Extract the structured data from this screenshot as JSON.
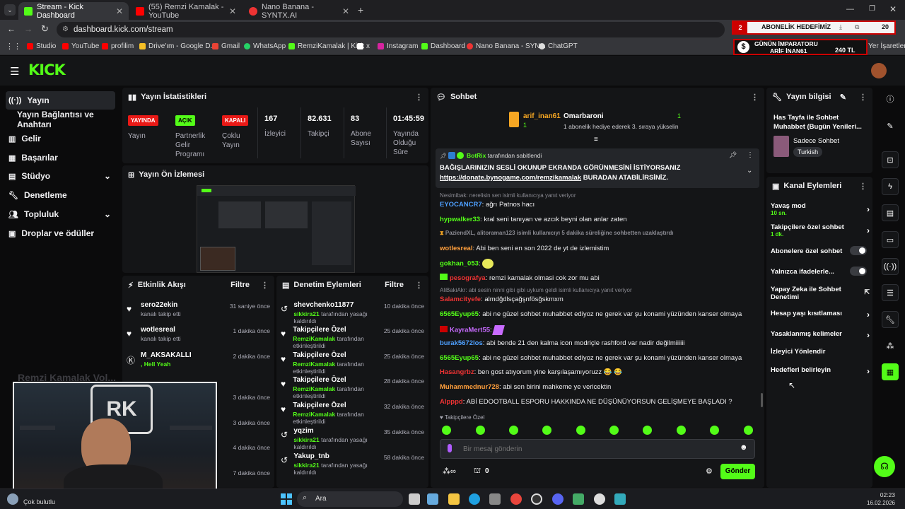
{
  "browser": {
    "tabs": [
      {
        "title": "Stream - Kick Dashboard",
        "color": "#53fc18"
      },
      {
        "title": "(55) Remzi Kamalak - YouTube",
        "color": "#ff0000"
      },
      {
        "title": "Nano Banana - SYNTX.AI",
        "color": "#e33"
      }
    ],
    "url": "dashboard.kick.com/stream",
    "bookmarks": [
      "Studio",
      "YouTube",
      "profilim",
      "Drive'ım - Google D...",
      "Gmail",
      "WhatsApp",
      "RemziKamalak | Kick",
      "x",
      "Instagram",
      "Dashboard",
      "Nano Banana - SYN...",
      "ChatGPT"
    ],
    "bookmarks_right": "Yer İşaretleri",
    "download_count": "20"
  },
  "overlay": {
    "goal_number": "2",
    "goal_label": "ABONELİK HEDEFİMİZ",
    "emperor_title": "GÜNÜN İMPARATORU",
    "emperor_name": "ARİF İNAN61",
    "emperor_amount": "240 TL",
    "watermark": "Remzi Kamalak Vol...",
    "webcam_logo": "RK"
  },
  "sidebar": {
    "items": [
      {
        "label": "Yayın",
        "icon": "broadcast-icon"
      },
      {
        "label": "Yayın Bağlantısı ve Anahtarı",
        "icon": ""
      },
      {
        "label": "Gelir",
        "icon": "revenue-icon"
      },
      {
        "label": "Başarılar",
        "icon": "achievements-icon"
      },
      {
        "label": "Stüdyo",
        "icon": "studio-icon"
      },
      {
        "label": "Denetleme",
        "icon": "moderation-icon"
      },
      {
        "label": "Topluluk",
        "icon": "community-icon"
      },
      {
        "label": "Droplar ve ödüller",
        "icon": "drops-icon"
      }
    ]
  },
  "stats": {
    "title": "Yayın İstatistikleri",
    "badges": [
      {
        "badge": "YAYINDA",
        "label": "Yayın",
        "color": "#e91916"
      },
      {
        "badge": "AÇIK",
        "label": "Partnerlik Gelir Programı",
        "color": "#53fc18"
      },
      {
        "badge": "KAPALI",
        "label": "Çoklu Yayın",
        "color": "#e91916"
      }
    ],
    "numbers": [
      {
        "value": "167",
        "label": "İzleyici"
      },
      {
        "value": "82.631",
        "label": "Takipçi"
      },
      {
        "value": "83",
        "label": "Abone Sayısı"
      },
      {
        "value": "01:45:59",
        "label": "Yayında Olduğu Süre"
      }
    ]
  },
  "preview": {
    "title": "Yayın Ön İzlemesi"
  },
  "activity": {
    "title": "Etkinlik Akışı",
    "filter": "Filtre",
    "rows": [
      {
        "name": "sero22ekin",
        "sub": "kanalı takip etti",
        "time": "31 saniye önce"
      },
      {
        "name": "wotlesreal",
        "sub": "kanalı takip etti",
        "time": "1 dakika önce"
      },
      {
        "name": "M_AKSAKALLI",
        "sub": ", Hell Yeah",
        "time": "2 dakika önce"
      },
      {
        "name": "",
        "sub": "",
        "time": "3 dakika önce"
      },
      {
        "name": "",
        "sub": "",
        "time": "3 dakika önce"
      },
      {
        "name": "",
        "sub": "",
        "time": "4 dakika önce"
      },
      {
        "name": "",
        "sub": "",
        "time": "7 dakika önce"
      }
    ]
  },
  "modlog": {
    "title": "Denetim Eylemleri",
    "filter": "Filtre",
    "rows": [
      {
        "name": "shevchenko11877",
        "by": "sikkira21",
        "sub": "tarafından yasağı kaldırıldı",
        "time": "10 dakika önce",
        "icon": "undo-icon"
      },
      {
        "name": "Takipçilere Özel",
        "by": "RemziKamalak",
        "sub": "tarafından etkinleştirildi",
        "time": "25 dakika önce",
        "icon": "heart-icon"
      },
      {
        "name": "Takipçilere Özel",
        "by": "RemziKamalak",
        "sub": "tarafından etkinleştirildi",
        "time": "25 dakika önce",
        "icon": "heart-icon"
      },
      {
        "name": "Takipçilere Özel",
        "by": "RemziKamalak",
        "sub": "tarafından etkinleştirildi",
        "time": "28 dakika önce",
        "icon": "heart-icon"
      },
      {
        "name": "Takipçilere Özel",
        "by": "RemziKamalak",
        "sub": "tarafından etkinleştirildi",
        "time": "32 dakika önce",
        "icon": "heart-icon"
      },
      {
        "name": "yqzim",
        "by": "sikkira21",
        "sub": "tarafından yasağı kaldırıldı",
        "time": "35 dakika önce",
        "icon": "undo-icon"
      },
      {
        "name": "Yakup_tnb",
        "by": "sikkira21",
        "sub": "tarafından yasağı kaldırıldı",
        "time": "58 dakika önce",
        "icon": "undo-icon"
      }
    ]
  },
  "chat": {
    "title": "Sohbet",
    "gift_user1": "arif_inan61",
    "gift_user2": "Omarbaroni",
    "gift_count1": "1",
    "gift_count2": "1",
    "gift_text": "1 abonelik hediye ederek 3. sıraya yükselin",
    "pinned_by": "BotRix",
    "pinned_suffix": "tarafından sabitlendi",
    "pinned_text": "BAĞIŞLARINIZIN SESLİ OKUNUP EKRANDA GÖRÜNMESİNİ İSTİYORSANIZ",
    "pinned_link": "https://donate.bynogame.com/remzikamalak",
    "pinned_tail": "BURADAN ATABİLİRSİNİZ.",
    "messages": [
      {
        "type": "reply",
        "text": "Nesimibak: nerelisin sen isimli kullanıcıya yanıt veriyor"
      },
      {
        "user": "EYOCANCR7",
        "color": "#4ea0ff",
        "text": "ağrı Patnos hacı"
      },
      {
        "user": "hypwalker33",
        "color": "#53fc18",
        "text": "kral seni tanıyan ve azcık beyni olan anlar zaten"
      },
      {
        "type": "sys",
        "text": "PaziendXL, alitoraman123 isimli kullanıcıyı 5 dakika süreliğine sohbetten uzaklaştırdı"
      },
      {
        "user": "wotlesreal",
        "color": "#ff9f3c",
        "text": "Abi ben seni en son 2022 de yt de izlemistim"
      },
      {
        "user": "gokhan_053",
        "color": "#53fc18",
        "text": ""
      },
      {
        "user": "pesografya",
        "color": "#e33",
        "text": "remzi kamalak olmasi cok zor mu abi"
      },
      {
        "type": "reply",
        "text": "AliBakiAkr: abi sesin ninni gibi gibi uykum geldi isimli kullanıcıya yanıt veriyor"
      },
      {
        "user": "Salamcityefe",
        "color": "#e33",
        "text": "almdğdlsçağşnfösğskmxm"
      },
      {
        "user": "6565Eyup65",
        "color": "#53fc18",
        "text": "abi ne güzel sohbet muhabbet ediyoz ne gerek var şu konami yüzünden kanser olmaya"
      },
      {
        "user": "KayraMert55",
        "color": "#c86bff",
        "text": ""
      },
      {
        "user": "burak5672los",
        "color": "#4ea0ff",
        "text": "abi bende 21 den kalma icon modriçle rashford var nadir değilmiiiiii"
      },
      {
        "user": "6565Eyup65",
        "color": "#53fc18",
        "text": "abi ne güzel sohbet muhabbet ediyoz ne gerek var şu konami yüzünden kanser olmaya"
      },
      {
        "user": "Hasangrbz",
        "color": "#e33",
        "text": "ben gost atıyorum yine karşılaşamıyoruzz 😂 😂"
      },
      {
        "user": "Muhammednur728",
        "color": "#ff9f3c",
        "text": "abi sen birini mahkeme ye vericektin"
      },
      {
        "user": "Alpppd",
        "color": "#e33",
        "text": "ABİ EDOOTBALL ESPORU HAKKINDA NE DÜŞÜNÜYORSUN GELİŞMEYE BAŞLADI ?"
      }
    ],
    "followers_only": "Takipçilere Özel",
    "input_placeholder": "Bir mesaj gönderin",
    "points": "0",
    "send_label": "Gönder"
  },
  "stream_info": {
    "title": "Yayın bilgisi",
    "stream_title": "Has Tayfa ile Sohbet Muhabbet (Bugün Yenileri...",
    "category": "Sadece Sohbet",
    "tag": "Turkish"
  },
  "channel_actions": {
    "title": "Kanal Eylemleri",
    "items": [
      {
        "label": "Yavaş mod",
        "sub": "10 sn.",
        "control": "chevron"
      },
      {
        "label": "Takipçilere özel sohbet",
        "sub": "1 dk.",
        "control": "chevron"
      },
      {
        "label": "Abonelere özel sohbet",
        "sub": "",
        "control": "toggle"
      },
      {
        "label": "Yalnızca ifadelerle...",
        "sub": "",
        "control": "toggle"
      },
      {
        "label": "Yapay Zeka ile Sohbet Denetimi",
        "sub": "",
        "control": "external"
      },
      {
        "label": "Hesap yaşı kısıtlaması",
        "sub": "",
        "control": "chevron"
      },
      {
        "label": "Yasaklanmış kelimeler",
        "sub": "",
        "control": "chevron"
      },
      {
        "label": "İzleyici Yönlendir",
        "sub": "",
        "control": ""
      },
      {
        "label": "Hedefleri belirleyin",
        "sub": "",
        "control": "chevron"
      }
    ]
  },
  "taskbar": {
    "weather": "Çok bulutlu",
    "search": "Ara",
    "time": "02:23",
    "date": "16.02.2026"
  }
}
